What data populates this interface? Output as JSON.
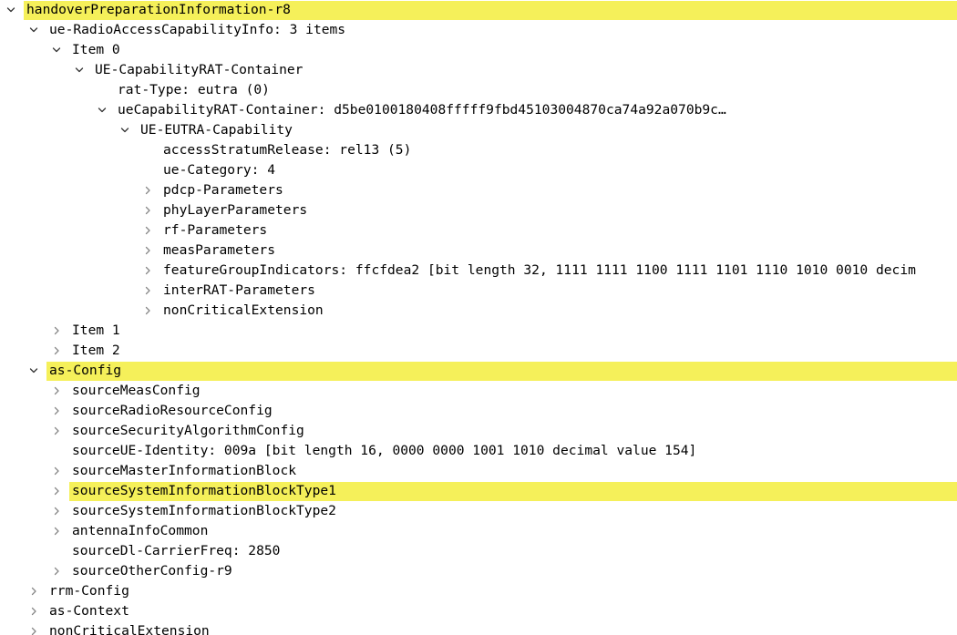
{
  "tree": {
    "rows": [
      {
        "text": "handoverPreparationInformation-r8",
        "level": 0,
        "toggle": "open",
        "highlight": true
      },
      {
        "text": "ue-RadioAccessCapabilityInfo: 3 items",
        "level": 1,
        "toggle": "open",
        "highlight": false
      },
      {
        "text": "Item 0",
        "level": 2,
        "toggle": "open",
        "highlight": false
      },
      {
        "text": "UE-CapabilityRAT-Container",
        "level": 3,
        "toggle": "open",
        "highlight": false
      },
      {
        "text": "rat-Type: eutra (0)",
        "level": 4,
        "toggle": "none",
        "highlight": false
      },
      {
        "text": "ueCapabilityRAT-Container: d5be0100180408fffff9fbd45103004870ca74a92a070b9c…",
        "level": 4,
        "toggle": "open",
        "highlight": false
      },
      {
        "text": "UE-EUTRA-Capability",
        "level": 5,
        "toggle": "open",
        "highlight": false
      },
      {
        "text": "accessStratumRelease: rel13 (5)",
        "level": 6,
        "toggle": "none",
        "highlight": false
      },
      {
        "text": "ue-Category: 4",
        "level": 6,
        "toggle": "none",
        "highlight": false
      },
      {
        "text": "pdcp-Parameters",
        "level": 6,
        "toggle": "closed",
        "highlight": false
      },
      {
        "text": "phyLayerParameters",
        "level": 6,
        "toggle": "closed",
        "highlight": false
      },
      {
        "text": "rf-Parameters",
        "level": 6,
        "toggle": "closed",
        "highlight": false
      },
      {
        "text": "measParameters",
        "level": 6,
        "toggle": "closed",
        "highlight": false
      },
      {
        "text": "featureGroupIndicators: ffcfdea2 [bit length 32, 1111 1111  1100 1111  1101 1110  1010 0010 decim",
        "level": 6,
        "toggle": "closed",
        "highlight": false
      },
      {
        "text": "interRAT-Parameters",
        "level": 6,
        "toggle": "closed",
        "highlight": false
      },
      {
        "text": "nonCriticalExtension",
        "level": 6,
        "toggle": "closed",
        "highlight": false
      },
      {
        "text": "Item 1",
        "level": 2,
        "toggle": "closed",
        "highlight": false
      },
      {
        "text": "Item 2",
        "level": 2,
        "toggle": "closed",
        "highlight": false
      },
      {
        "text": "as-Config",
        "level": 1,
        "toggle": "open",
        "highlight": true
      },
      {
        "text": "sourceMeasConfig",
        "level": 2,
        "toggle": "closed",
        "highlight": false
      },
      {
        "text": "sourceRadioResourceConfig",
        "level": 2,
        "toggle": "closed",
        "highlight": false
      },
      {
        "text": "sourceSecurityAlgorithmConfig",
        "level": 2,
        "toggle": "closed",
        "highlight": false
      },
      {
        "text": "sourceUE-Identity: 009a [bit length 16, 0000 0000  1001 1010 decimal value 154]",
        "level": 2,
        "toggle": "none",
        "highlight": false
      },
      {
        "text": "sourceMasterInformationBlock",
        "level": 2,
        "toggle": "closed",
        "highlight": false
      },
      {
        "text": "sourceSystemInformationBlockType1",
        "level": 2,
        "toggle": "closed",
        "highlight": true
      },
      {
        "text": "sourceSystemInformationBlockType2",
        "level": 2,
        "toggle": "closed",
        "highlight": false
      },
      {
        "text": "antennaInfoCommon",
        "level": 2,
        "toggle": "closed",
        "highlight": false
      },
      {
        "text": "sourceDl-CarrierFreq: 2850",
        "level": 2,
        "toggle": "none",
        "highlight": false
      },
      {
        "text": "sourceOtherConfig-r9",
        "level": 2,
        "toggle": "closed",
        "highlight": false
      },
      {
        "text": "rrm-Config",
        "level": 1,
        "toggle": "closed",
        "highlight": false
      },
      {
        "text": "as-Context",
        "level": 1,
        "toggle": "closed",
        "highlight": false
      },
      {
        "text": "nonCriticalExtension",
        "level": 1,
        "toggle": "closed",
        "highlight": false
      }
    ],
    "colors": {
      "highlight": "#f5f05a",
      "text": "#000000",
      "toggle_open": "#333333",
      "toggle_closed": "#888888",
      "background": "#ffffff"
    },
    "icons": {
      "open": "chevron-down-icon",
      "closed": "chevron-right-icon"
    }
  }
}
